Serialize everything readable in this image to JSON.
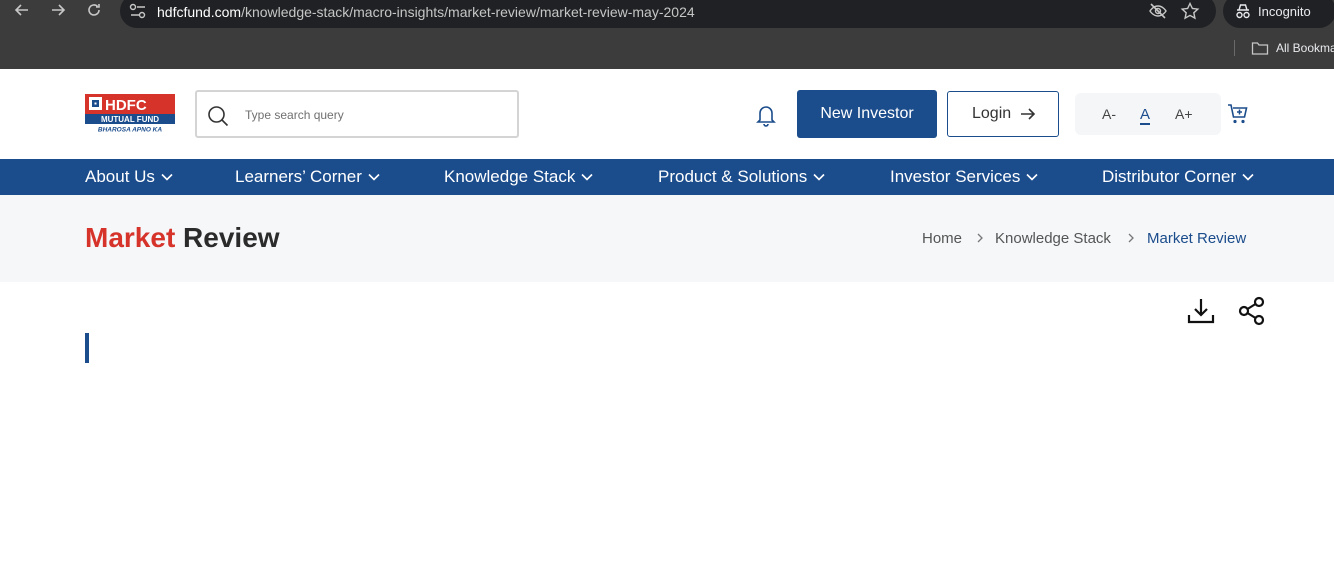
{
  "browser": {
    "url_host": "hdfcfund.com",
    "url_path": "/knowledge-stack/macro-insights/market-review/market-review-may-2024",
    "profile_label": "Incognito",
    "bookmarks_label": "All Bookma"
  },
  "header": {
    "logo_line1": "HDFC",
    "logo_line2": "MUTUAL FUND",
    "logo_tagline": "BHAROSA APNO KA",
    "search_placeholder": "Type search query",
    "new_investor_label": "New Investor",
    "login_label": "Login",
    "font_decrease": "A-",
    "font_normal": "A",
    "font_increase": "A+"
  },
  "nav": {
    "items": [
      {
        "label": "About Us"
      },
      {
        "label": "Learners’ Corner"
      },
      {
        "label": "Knowledge Stack"
      },
      {
        "label": "Product & Solutions"
      },
      {
        "label": "Investor Services"
      },
      {
        "label": "Distributor Corner"
      }
    ]
  },
  "page": {
    "title_part1": "Market",
    "title_part2": "Review",
    "breadcrumb": [
      {
        "label": "Home"
      },
      {
        "label": "Knowledge Stack"
      },
      {
        "label": "Market Review"
      }
    ]
  },
  "colors": {
    "brand_blue": "#1b4c8c",
    "brand_red": "#d6332b",
    "band_bg": "#f5f7f9"
  }
}
